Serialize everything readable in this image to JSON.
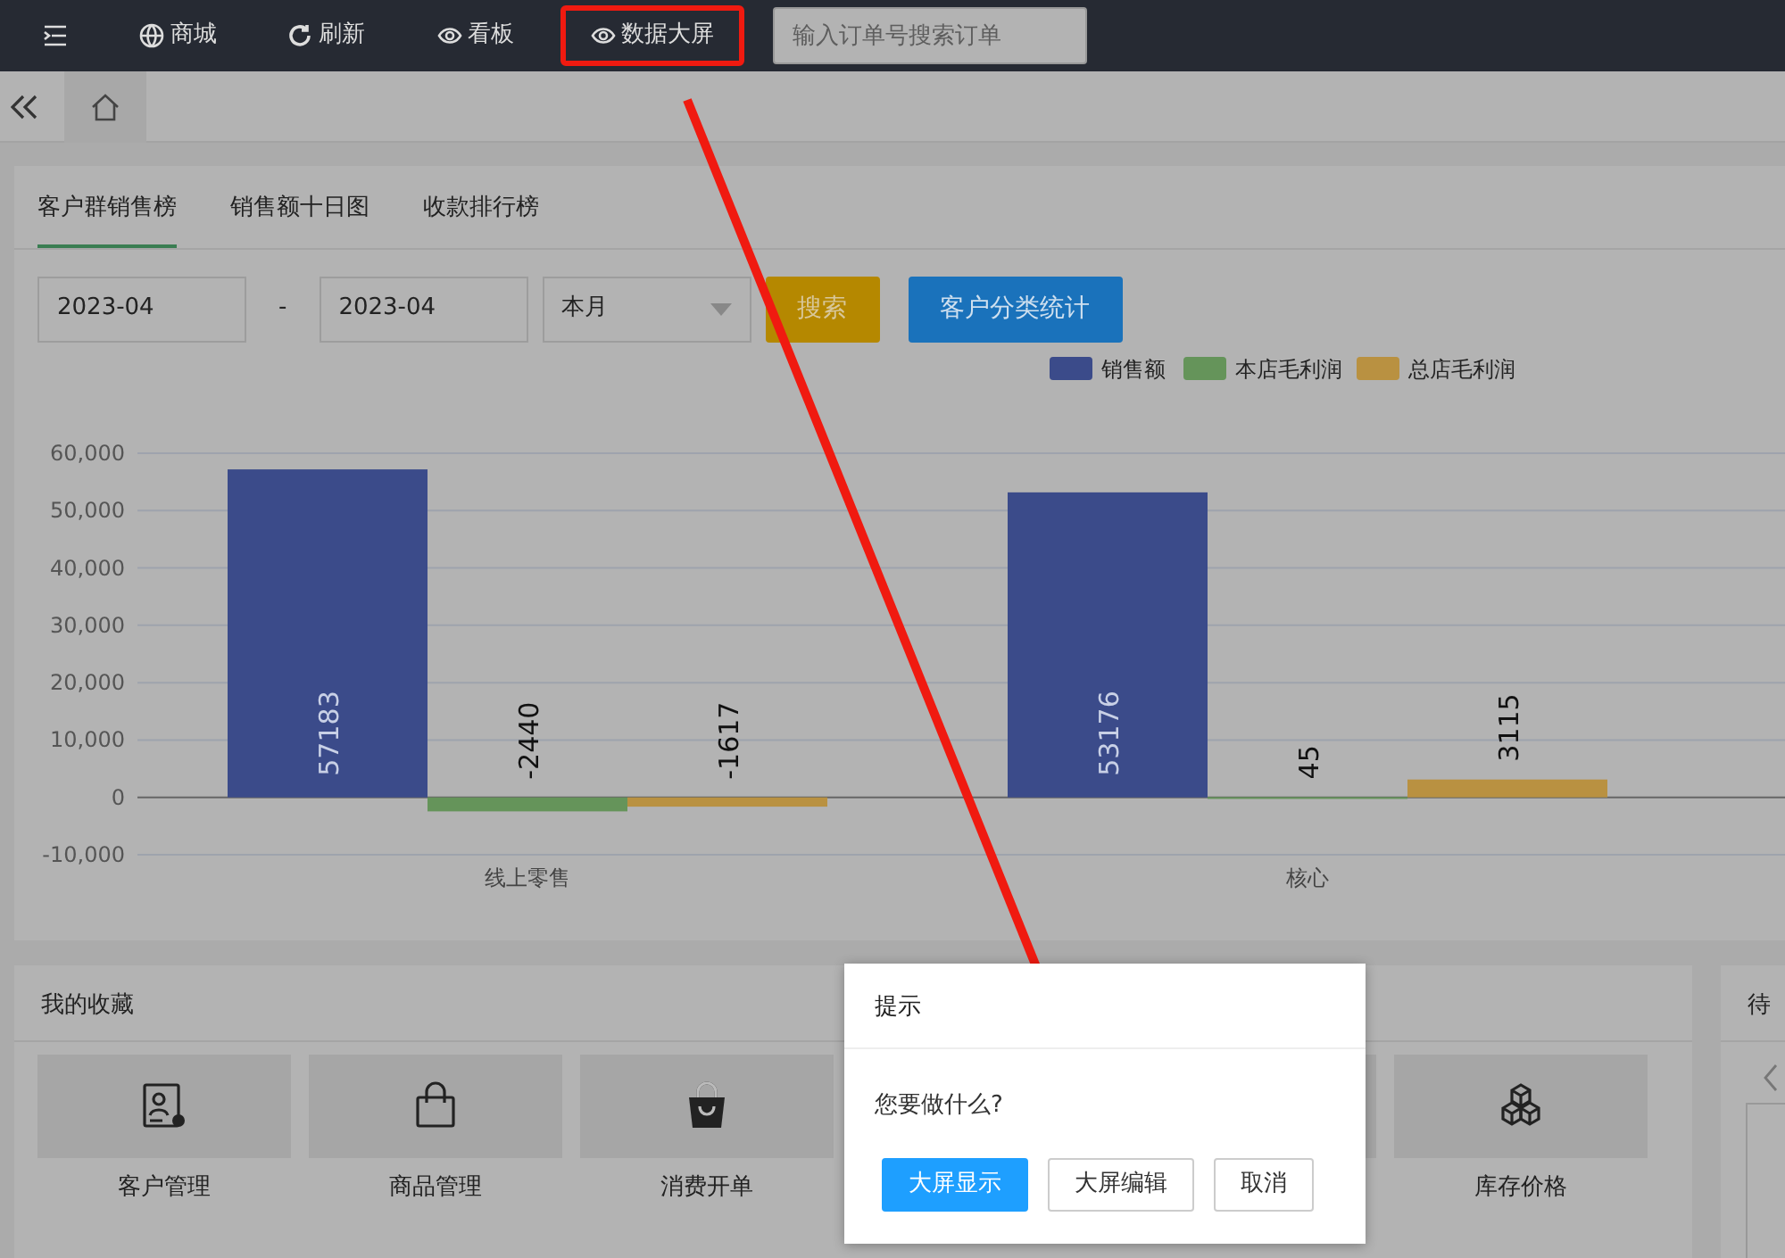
{
  "toolbar": {
    "items": [
      {
        "kind": "menu",
        "highlighted": false
      },
      {
        "kind": "globe",
        "label": "商城",
        "highlighted": false
      },
      {
        "kind": "refresh",
        "label": "刷新",
        "highlighted": false
      },
      {
        "kind": "eye",
        "label": "看板",
        "highlighted": false
      },
      {
        "kind": "eye",
        "label": "数据大屏",
        "highlighted": true
      }
    ],
    "search": {
      "placeholder": "输入订单号搜索订单"
    }
  },
  "tabs": [
    {
      "label": "客户群销售榜",
      "selected": true
    },
    {
      "label": "销售额十日图",
      "selected": false
    },
    {
      "label": "收款排行榜",
      "selected": false
    }
  ],
  "filters": {
    "date_from": "2023-04",
    "separator": "-",
    "date_to": "2023-04",
    "period": "本月",
    "buttons": [
      {
        "label": "搜索",
        "kind": "warning"
      },
      {
        "label": "客户分类统计",
        "kind": "primary"
      }
    ]
  },
  "chart_data": {
    "type": "bar",
    "categories": [
      "线上零售",
      "核心"
    ],
    "series": [
      {
        "name": "销售额",
        "color": "#3b4b8a",
        "values": [
          57183,
          53176
        ]
      },
      {
        "name": "本店毛利润",
        "color": "#65945a",
        "values": [
          -2440,
          45
        ]
      },
      {
        "name": "总店毛利润",
        "color": "#b99141",
        "values": [
          -1617,
          3115
        ]
      }
    ],
    "ylim": [
      -10000,
      60000
    ],
    "yticks": [
      {
        "value": -10000,
        "label": "-10,000"
      },
      {
        "value": 0,
        "label": "0"
      },
      {
        "value": 10000,
        "label": "10,000"
      },
      {
        "value": 20000,
        "label": "20,000"
      },
      {
        "value": 30000,
        "label": "30,000"
      },
      {
        "value": 40000,
        "label": "40,000"
      },
      {
        "value": 50000,
        "label": "50,000"
      },
      {
        "value": 60000,
        "label": "60,000"
      }
    ],
    "data_labels": true,
    "grid": true,
    "legend": true
  },
  "favorites": {
    "title": "我的收藏",
    "items": [
      {
        "label": "客户管理",
        "kind": "contact"
      },
      {
        "label": "商品管理",
        "kind": "bag"
      },
      {
        "label": "消费开单",
        "kind": "basket"
      },
      {
        "label": "库存价格",
        "kind": "boxes"
      }
    ]
  },
  "todo": {
    "title": "待"
  },
  "dialog": {
    "title": "提示",
    "message": "您要做什么?",
    "buttons": [
      {
        "label": "大屏显示",
        "primary": true
      },
      {
        "label": "大屏编辑",
        "primary": false
      },
      {
        "label": "取消",
        "primary": false
      }
    ]
  }
}
